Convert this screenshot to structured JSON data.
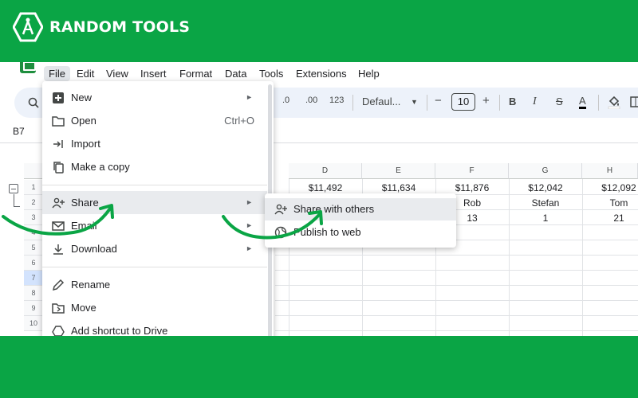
{
  "brand": {
    "name": "RANDOM TOOLS",
    "icon": "compass-logo-icon"
  },
  "colors": {
    "brand_green": "#0aa545",
    "sheets_green": "#1e8e3e",
    "arrow_green": "#0aa545"
  },
  "menubar": [
    "File",
    "Edit",
    "View",
    "Insert",
    "Format",
    "Data",
    "Tools",
    "Extensions",
    "Help"
  ],
  "toolbar": {
    "decimal_decrease": ".0",
    "decimal_increase": ".00",
    "number_format": "123",
    "font": "Defaul...",
    "minus": "−",
    "font_size": "10",
    "plus": "+",
    "bold": "B",
    "italic": "I",
    "strike": "S",
    "text_color": "A"
  },
  "namebox": "B7",
  "columns": [
    "D",
    "E",
    "F",
    "G",
    "H"
  ],
  "rows": [
    "1",
    "2",
    "3",
    "4",
    "5",
    "6",
    "7",
    "8",
    "9",
    "10"
  ],
  "cells": {
    "r1": [
      "$11,492",
      "$11,634",
      "$11,876",
      "$12,042",
      "$12,092"
    ],
    "r2": [
      "Rob",
      "Stefan",
      "Tom"
    ],
    "r3": [
      "13",
      "1",
      "21"
    ]
  },
  "file_menu": {
    "new": "New",
    "open": "Open",
    "open_shortcut": "Ctrl+O",
    "import": "Import",
    "copy": "Make a copy",
    "share": "Share",
    "email": "Email",
    "download": "Download",
    "rename": "Rename",
    "move": "Move",
    "shortcut": "Add shortcut to Drive",
    "submenu_arrow": "►"
  },
  "share_submenu": {
    "share_with_others": "Share with others",
    "publish": "Publish to web"
  }
}
